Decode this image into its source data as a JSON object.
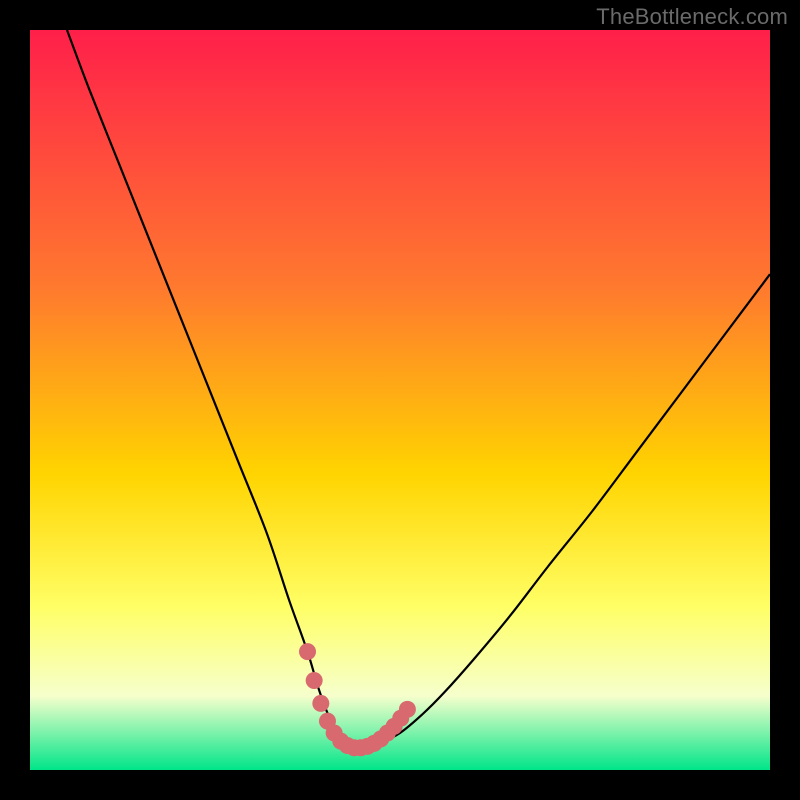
{
  "watermark": "TheBottleneck.com",
  "colors": {
    "frame": "#000000",
    "gradient_top": "#ff1f4a",
    "gradient_mid1": "#ff7a2e",
    "gradient_mid2": "#ffd400",
    "gradient_mid3": "#ffff66",
    "gradient_mid4": "#f6ffcc",
    "gradient_bottom": "#00e589",
    "curve": "#000000",
    "marker": "#d86a6f"
  },
  "chart_data": {
    "type": "line",
    "title": "",
    "xlabel": "",
    "ylabel": "",
    "xlim": [
      0,
      100
    ],
    "ylim": [
      0,
      100
    ],
    "series": [
      {
        "name": "curve",
        "x": [
          5,
          8,
          12,
          16,
          20,
          24,
          28,
          32,
          35,
          37.5,
          39,
          40.5,
          42,
          43.5,
          45,
          47,
          50,
          53,
          56,
          60,
          65,
          70,
          76,
          82,
          88,
          94,
          100
        ],
        "y": [
          100,
          92,
          82,
          72,
          62,
          52,
          42,
          32,
          23,
          16,
          11,
          7,
          4.5,
          3,
          3,
          3.5,
          5,
          7.5,
          10.5,
          15,
          21,
          27.5,
          35,
          43,
          51,
          59,
          67
        ]
      },
      {
        "name": "sweet-spot-markers",
        "x": [
          37.5,
          38.4,
          39.3,
          40.2,
          41.1,
          42.0,
          42.9,
          43.8,
          44.7,
          45.6,
          46.5,
          47.4,
          48.3,
          49.2,
          50.1,
          51.0
        ],
        "y": [
          16.0,
          12.1,
          9.0,
          6.6,
          5.0,
          3.9,
          3.3,
          3.0,
          3.0,
          3.2,
          3.6,
          4.2,
          5.0,
          5.9,
          7.0,
          8.2
        ]
      }
    ],
    "annotations": []
  }
}
